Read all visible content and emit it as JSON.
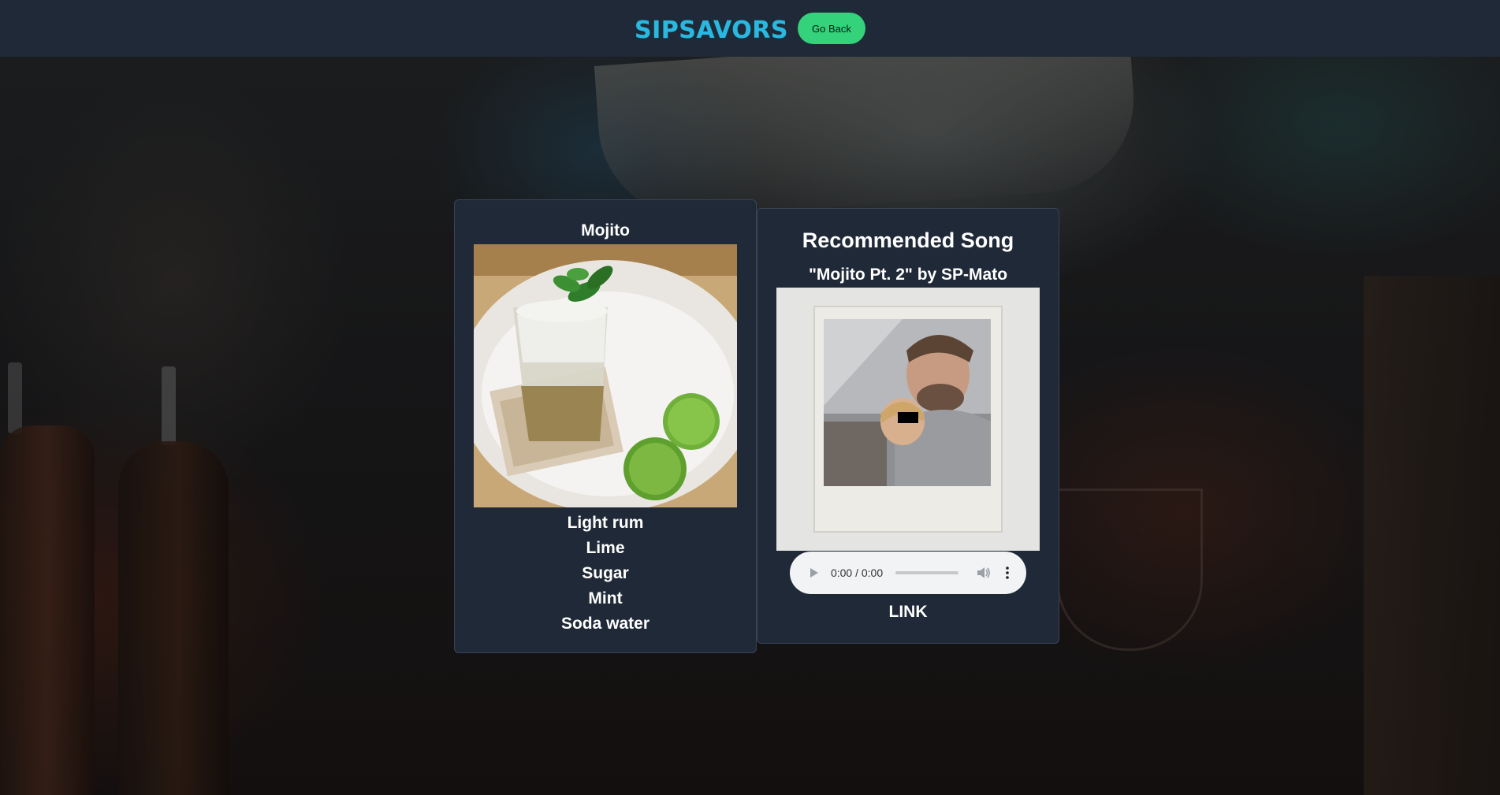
{
  "header": {
    "logo_text": "SIPSAVORS",
    "go_back_label": "Go Back"
  },
  "drink": {
    "name": "Mojito",
    "ingredients": [
      "Light rum",
      "Lime",
      "Sugar",
      "Mint",
      "Soda water"
    ]
  },
  "song": {
    "heading": "Recommended Song",
    "title": "\"Mojito Pt. 2\" by SP-Mato",
    "player_time": "0:00 / 0:00",
    "link_label": "LINK"
  },
  "colors": {
    "header_bg": "#1f2937",
    "card_bg": "#1f2937",
    "logo": "#2bb8e0",
    "button": "#34d27a"
  }
}
